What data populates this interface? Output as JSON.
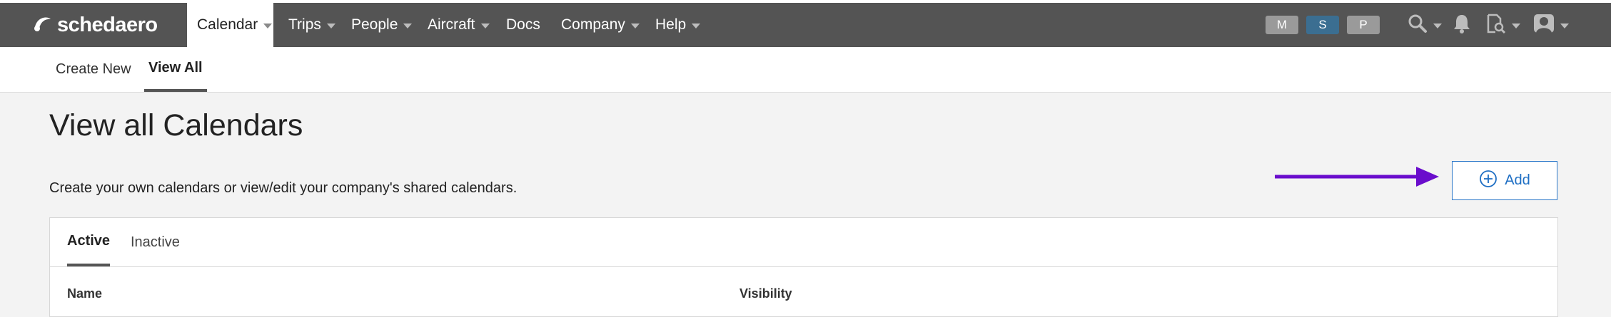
{
  "brand": {
    "logo_text": "schedaero"
  },
  "navbar": {
    "items": [
      {
        "label": "Calendar",
        "active": true,
        "has_dropdown": true
      },
      {
        "label": "Trips",
        "has_dropdown": true
      },
      {
        "label": "People",
        "has_dropdown": true
      },
      {
        "label": "Aircraft",
        "has_dropdown": true
      },
      {
        "label": "Docs",
        "has_dropdown": false
      },
      {
        "label": "Company",
        "has_dropdown": true
      },
      {
        "label": "Help",
        "has_dropdown": true
      }
    ],
    "mode_pills": [
      {
        "label": "M",
        "color": "#9a9a9a"
      },
      {
        "label": "S",
        "color": "#3b6e91"
      },
      {
        "label": "P",
        "color": "#9a9a9a"
      }
    ],
    "icons": [
      "search-icon",
      "bell-icon",
      "document-search-icon",
      "user-avatar-icon"
    ]
  },
  "subnav": {
    "tabs": [
      {
        "label": "Create New",
        "active": false
      },
      {
        "label": "View All",
        "active": true
      }
    ]
  },
  "page": {
    "title": "View all Calendars",
    "description": "Create your own calendars or view/edit your company's shared calendars.",
    "add_label": "Add"
  },
  "panel": {
    "tabs": [
      {
        "label": "Active",
        "active": true
      },
      {
        "label": "Inactive",
        "active": false
      }
    ],
    "columns": [
      "Name",
      "Visibility"
    ]
  },
  "colors": {
    "navbar": "#545454",
    "accent": "#1f6fc4",
    "annotation_arrow": "#6a0dcc"
  }
}
